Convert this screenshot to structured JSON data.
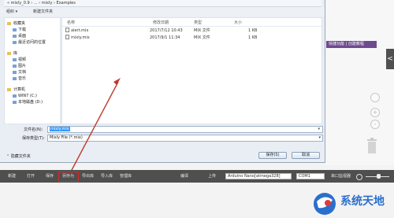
{
  "background": {
    "purple_tab": "快捷功能 | 创建教程",
    "right_arrow": "<",
    "zoom_buttons": [
      "+",
      "-"
    ]
  },
  "dialog": {
    "address_bar": "« mixly_0.9 › ... › mixly › Examples",
    "toolbar": {
      "organize": "组织 ▾",
      "new_folder": "新建文件夹"
    },
    "nav": [
      {
        "label": "收藏夹",
        "level": 0
      },
      {
        "label": "下载",
        "level": 1
      },
      {
        "label": "桌面",
        "level": 1
      },
      {
        "label": "最近访问的位置",
        "level": 1
      },
      {
        "label": "库",
        "level": 0
      },
      {
        "label": "视频",
        "level": 1
      },
      {
        "label": "图片",
        "level": 1
      },
      {
        "label": "文档",
        "level": 1
      },
      {
        "label": "音乐",
        "level": 1
      },
      {
        "label": "计算机",
        "level": 0
      },
      {
        "label": "WIN7 (C:)",
        "level": 1
      },
      {
        "label": "本地磁盘 (D:)",
        "level": 1
      }
    ],
    "columns": {
      "name": "名称",
      "modified": "修改日期",
      "type": "类型",
      "size": "大小"
    },
    "files": [
      {
        "name": "alert.mix",
        "modified": "2017/7/12 10:43",
        "type": "MIX 文件",
        "size": "1 KB"
      },
      {
        "name": "mixly.mix",
        "modified": "2017/9/1 11:34",
        "type": "MIX 文件",
        "size": "1 KB"
      }
    ],
    "filename_label": "文件名(N):",
    "filename_value": "mixly.mix",
    "filetype_label": "保存类型(T):",
    "filetype_value": "Mixly File (*.mix)",
    "hide_folders": "隐藏文件夹",
    "save_button": "保存(S)",
    "cancel_button": "取消"
  },
  "app_toolbar": {
    "buttons": [
      "新建",
      "打开",
      "保存",
      "另存为",
      "导出库",
      "导入库",
      "管理库"
    ],
    "compile": "编译",
    "upload": "上传",
    "board": "Arduino Nano[atmega328]",
    "port": "COM1",
    "serial_monitor": "串口监视器"
  },
  "watermark": {
    "text": "系统天地"
  },
  "colors": {
    "toolbar_bg": "#4f4f4f",
    "highlight": "#d62a2a",
    "selection": "#3399ff",
    "purple": "#6e4a8e"
  }
}
